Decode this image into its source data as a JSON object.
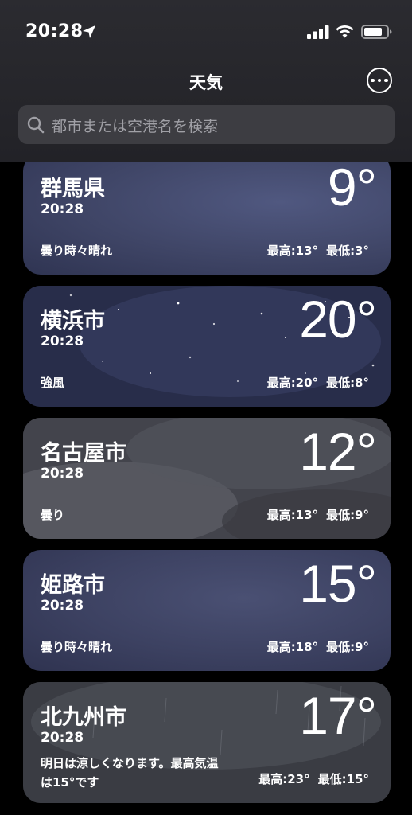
{
  "status_bar": {
    "time": "20:28"
  },
  "header": {
    "title": "天気",
    "search_placeholder": "都市または空港名を検索"
  },
  "icons": {
    "location": "location-arrow-icon",
    "signal": "cellular-signal-icon",
    "wifi": "wifi-icon",
    "battery": "battery-icon",
    "more": "ellipsis-circle-icon",
    "search": "magnifying-glass-icon"
  },
  "locations": [
    {
      "city": "群馬県",
      "time": "20:28",
      "temp": "9°",
      "condition": "曇り時々晴れ",
      "high": "最高:13°",
      "low": "最低:3°"
    },
    {
      "city": "横浜市",
      "time": "20:28",
      "temp": "20°",
      "condition": "強風",
      "high": "最高:20°",
      "low": "最低:8°"
    },
    {
      "city": "名古屋市",
      "time": "20:28",
      "temp": "12°",
      "condition": "曇り",
      "high": "最高:13°",
      "low": "最低:9°"
    },
    {
      "city": "姫路市",
      "time": "20:28",
      "temp": "15°",
      "condition": "曇り時々晴れ",
      "high": "最高:18°",
      "low": "最低:9°"
    },
    {
      "city": "北九州市",
      "time": "20:28",
      "temp": "17°",
      "condition_line1": "明日は涼しくなります。最高気温",
      "condition_line2": "は15°です",
      "high": "最高:23°",
      "low": "最低:15°"
    }
  ],
  "colors": {
    "background": "#000000",
    "header": "#2b2b30",
    "search_field": "#3d3d42",
    "placeholder": "#a0a0a6"
  }
}
